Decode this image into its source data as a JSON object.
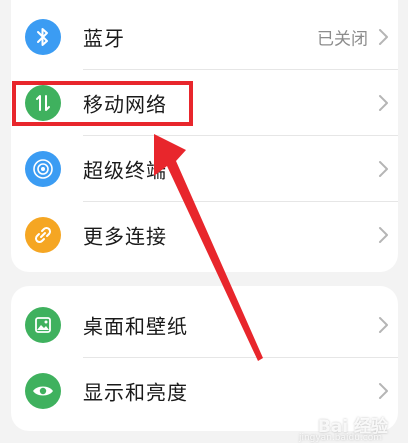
{
  "settings_group_1": {
    "items": [
      {
        "label": "蓝牙",
        "value": "已关闭",
        "icon": "bluetooth-icon",
        "icon_color": "#3b9cf3"
      },
      {
        "label": "移动网络",
        "value": "",
        "icon": "mobile-data-icon",
        "icon_color": "#3fb15e"
      },
      {
        "label": "超级终端",
        "value": "",
        "icon": "super-device-icon",
        "icon_color": "#3b9cf3"
      },
      {
        "label": "更多连接",
        "value": "",
        "icon": "link-icon",
        "icon_color": "#f5a623"
      }
    ]
  },
  "settings_group_2": {
    "items": [
      {
        "label": "桌面和壁纸",
        "value": "",
        "icon": "wallpaper-icon",
        "icon_color": "#3fb15e"
      },
      {
        "label": "显示和亮度",
        "value": "",
        "icon": "display-eye-icon",
        "icon_color": "#3fb15e"
      }
    ]
  },
  "annotation": {
    "highlight_color": "#e8262c"
  },
  "watermark": {
    "text": "Bai 经验",
    "subtext": "jingyan.baidu.com"
  }
}
